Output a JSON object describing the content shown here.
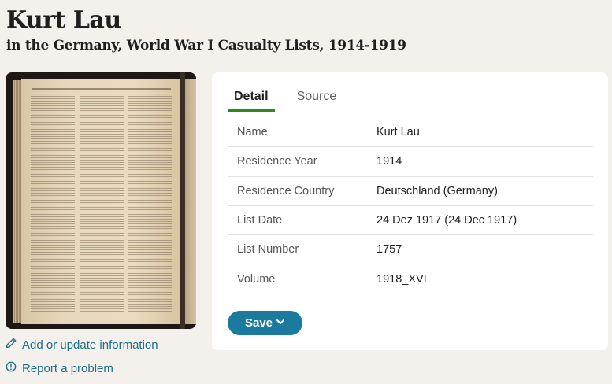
{
  "header": {
    "title": "Kurt Lau",
    "subtitle": "in the Germany, World War I Casualty Lists, 1914-1919"
  },
  "sidebar": {
    "links": [
      {
        "label": "Add or update information",
        "icon": "pencil-icon"
      },
      {
        "label": "Report a problem",
        "icon": "alert-circle-icon"
      }
    ]
  },
  "card": {
    "tabs": [
      {
        "label": "Detail",
        "active": true
      },
      {
        "label": "Source",
        "active": false
      }
    ],
    "rows": [
      {
        "label": "Name",
        "value": "Kurt Lau"
      },
      {
        "label": "Residence Year",
        "value": "1914"
      },
      {
        "label": "Residence Country",
        "value": "Deutschland (Germany)"
      },
      {
        "label": "List Date",
        "value": "24 Dez 1917 (24 Dec 1917)"
      },
      {
        "label": "List Number",
        "value": "1757"
      },
      {
        "label": "Volume",
        "value": "1918_XVI"
      }
    ],
    "save_label": "Save"
  },
  "colors": {
    "accent": "#1a7b9e",
    "tab_underline": "#2f8a1c",
    "link": "#1b6f86",
    "background": "#f4f1ed"
  }
}
